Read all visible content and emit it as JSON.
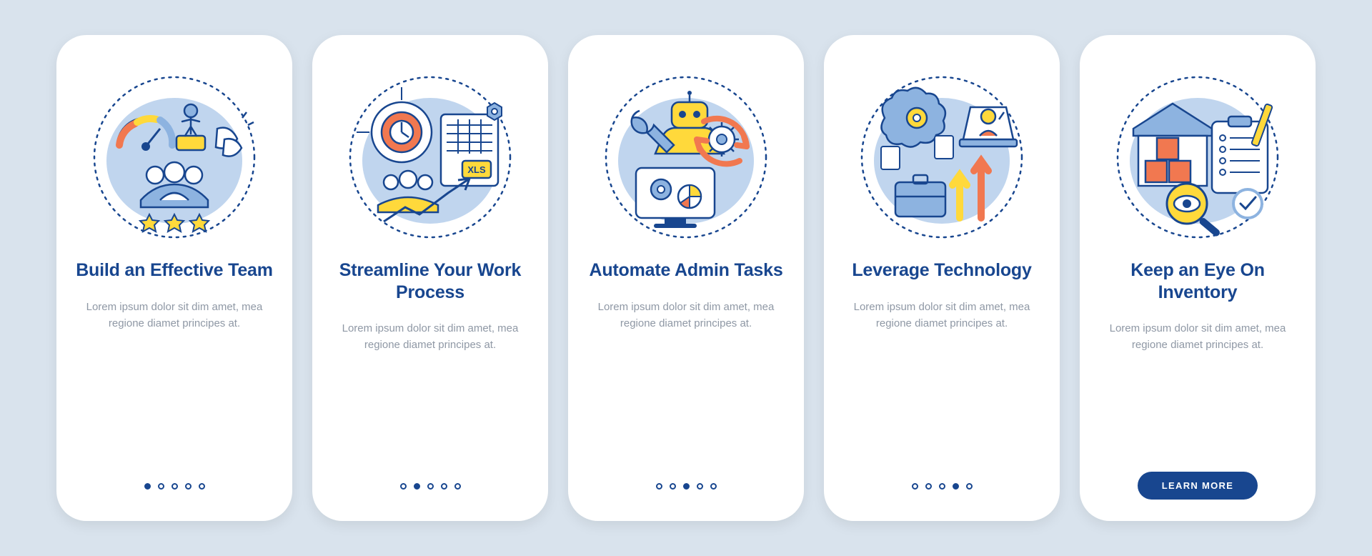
{
  "colors": {
    "accent": "#18468f",
    "yellow": "#ffd93b",
    "orange": "#f17850",
    "lightblue": "#8db3e0",
    "midblue": "#5280c9",
    "bg": "#d9e3ed"
  },
  "screens": [
    {
      "title": "Build an Effective Team",
      "desc": "Lorem ipsum dolor sit dim amet, mea regione diamet principes at.",
      "illus": "team-icon",
      "active_dot": 0
    },
    {
      "title": "Streamline Your Work Process",
      "desc": "Lorem ipsum dolor sit dim amet, mea regione diamet principes at.",
      "illus": "streamline-icon",
      "active_dot": 1
    },
    {
      "title": "Automate Admin Tasks",
      "desc": "Lorem ipsum dolor sit dim amet, mea regione diamet principes at.",
      "illus": "automate-icon",
      "active_dot": 2
    },
    {
      "title": "Leverage Technology",
      "desc": "Lorem ipsum dolor sit dim amet, mea regione diamet principes at.",
      "illus": "technology-icon",
      "active_dot": 3
    },
    {
      "title": "Keep an Eye On Inventory",
      "desc": "Lorem ipsum dolor sit dim amet, mea regione diamet principes at.",
      "illus": "inventory-icon",
      "active_dot": 4,
      "cta": "LEARN MORE"
    }
  ],
  "dot_count": 5
}
